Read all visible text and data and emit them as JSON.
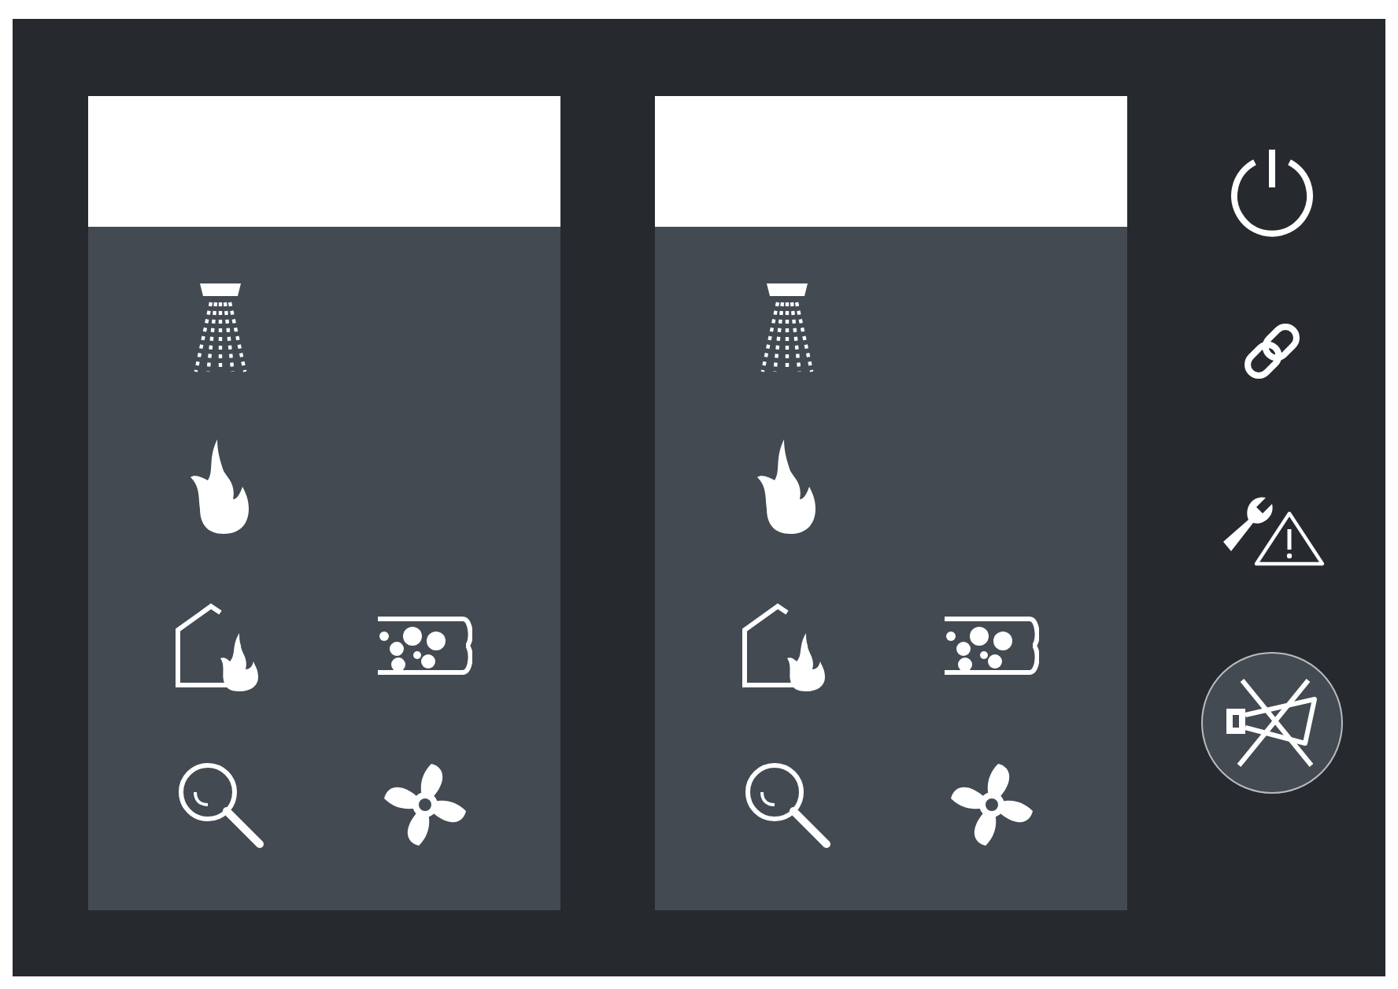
{
  "zones": [
    {
      "header_lit": true,
      "rows": [
        {
          "items": [
            {
              "kind": "sprinkler"
            }
          ]
        },
        {
          "items": [
            {
              "kind": "fire"
            }
          ]
        },
        {
          "items": [
            {
              "kind": "building-fire"
            },
            {
              "kind": "pipe"
            }
          ]
        },
        {
          "items": [
            {
              "kind": "search"
            },
            {
              "kind": "fan"
            }
          ]
        }
      ]
    },
    {
      "header_lit": true,
      "rows": [
        {
          "items": [
            {
              "kind": "sprinkler"
            }
          ]
        },
        {
          "items": [
            {
              "kind": "fire"
            }
          ]
        },
        {
          "items": [
            {
              "kind": "building-fire"
            },
            {
              "kind": "pipe"
            }
          ]
        },
        {
          "items": [
            {
              "kind": "search"
            },
            {
              "kind": "fan"
            }
          ]
        }
      ]
    }
  ],
  "controls": [
    {
      "kind": "power",
      "selected": false
    },
    {
      "kind": "link",
      "selected": false
    },
    {
      "kind": "maintenance-warning",
      "selected": false
    },
    {
      "kind": "horn-silence",
      "selected": true
    }
  ]
}
